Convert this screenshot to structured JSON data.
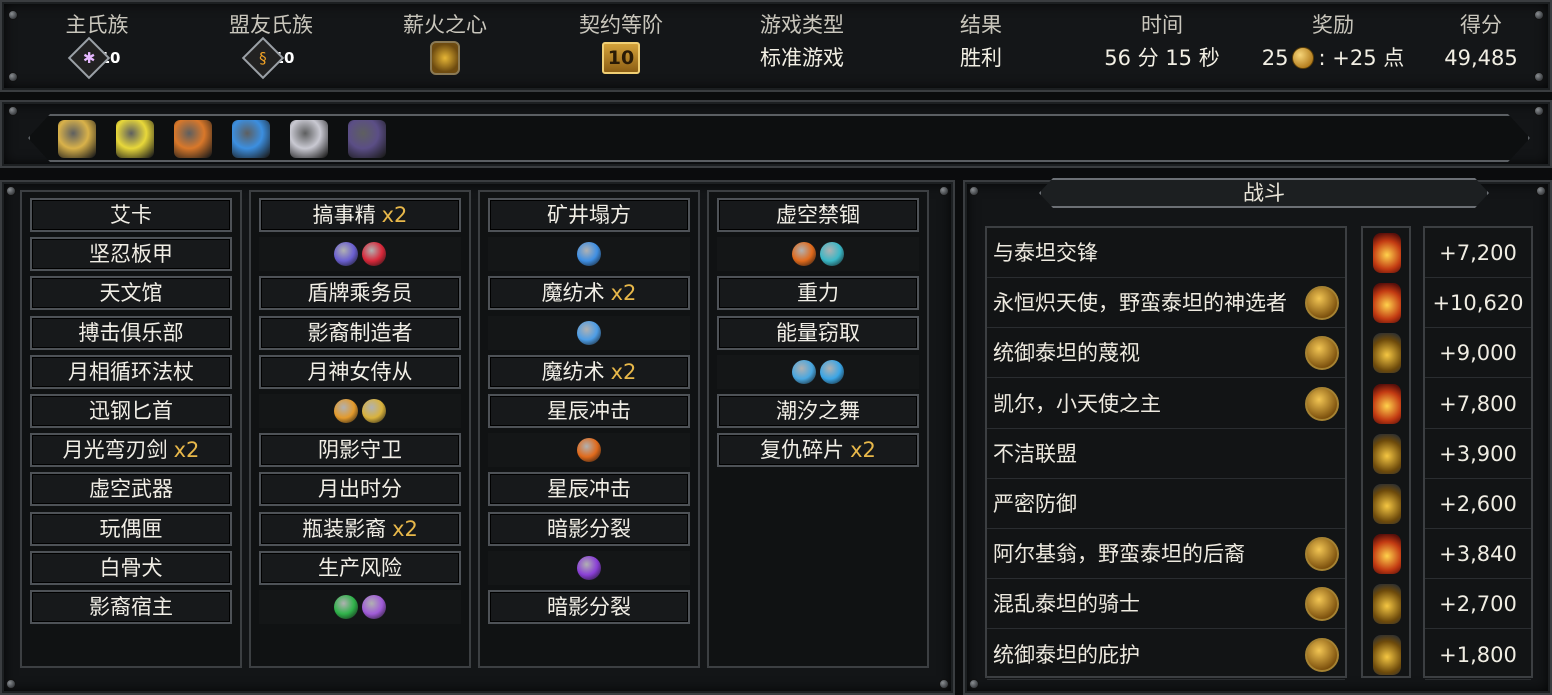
{
  "stats": [
    {
      "label": "主氏族",
      "value": "10",
      "kind": "tribe",
      "icon": "spider-icon"
    },
    {
      "label": "盟友氏族",
      "value": "10",
      "kind": "tribe",
      "icon": "flame-rune-icon"
    },
    {
      "label": "薪火之心",
      "value": "",
      "kind": "orb",
      "icon": "ember-heart-icon"
    },
    {
      "label": "契约等阶",
      "value": "10",
      "kind": "book",
      "icon": "covenant-book-icon"
    },
    {
      "label": "游戏类型",
      "value": "标准游戏",
      "kind": "text"
    },
    {
      "label": "结果",
      "value": "胜利",
      "kind": "text"
    },
    {
      "label": "时间",
      "value": "56 分 15 秒",
      "kind": "text"
    },
    {
      "label": "奖励",
      "value_pre": "25",
      "value_post": ": +25 点",
      "kind": "reward"
    },
    {
      "label": "得分",
      "value": "49,485",
      "kind": "text"
    }
  ],
  "relics": [
    {
      "name": "gold-coin-relic-icon",
      "color": "#d9b24a"
    },
    {
      "name": "yellow-crystal-relic-icon",
      "color": "#e8d83a"
    },
    {
      "name": "flame-frame-relic-icon",
      "color": "#d9782a"
    },
    {
      "name": "blue-shard-relic-icon",
      "color": "#3c8fe0"
    },
    {
      "name": "silver-ring-relic-icon",
      "color": "#c9c9d2"
    },
    {
      "name": "shadow-orb-relic-icon",
      "color": "#5b4e86"
    }
  ],
  "columns": [
    [
      {
        "type": "card",
        "label": "艾卡"
      },
      {
        "type": "card",
        "label": "坚忍板甲"
      },
      {
        "type": "card",
        "label": "天文馆"
      },
      {
        "type": "card",
        "label": "搏击俱乐部"
      },
      {
        "type": "card",
        "label": "月相循环法杖"
      },
      {
        "type": "card",
        "label": "迅钢匕首"
      },
      {
        "type": "card",
        "label": "月光弯刃剑",
        "count": "x2"
      },
      {
        "type": "card",
        "label": "虚空武器"
      },
      {
        "type": "card",
        "label": "玩偶匣"
      },
      {
        "type": "card",
        "label": "白骨犬"
      },
      {
        "type": "card",
        "label": "影裔宿主"
      }
    ],
    [
      {
        "type": "card",
        "label": "搞事精",
        "count": "x2"
      },
      {
        "type": "icons",
        "icons": [
          {
            "name": "moon-icon",
            "color": "#6a5fd0"
          },
          {
            "name": "heart-icon",
            "color": "#d8283a"
          }
        ]
      },
      {
        "type": "card",
        "label": "盾牌乘务员"
      },
      {
        "type": "card",
        "label": "影裔制造者"
      },
      {
        "type": "card",
        "label": "月神女侍从"
      },
      {
        "type": "icons",
        "icons": [
          {
            "name": "boot-icon",
            "color": "#e39a2c"
          },
          {
            "name": "crown-icon",
            "color": "#d9b23c"
          }
        ]
      },
      {
        "type": "card",
        "label": "阴影守卫"
      },
      {
        "type": "card",
        "label": "月出时分"
      },
      {
        "type": "card",
        "label": "瓶装影裔",
        "count": "x2"
      },
      {
        "type": "card",
        "label": "生产风险"
      },
      {
        "type": "icons",
        "icons": [
          {
            "name": "eye-icon",
            "color": "#2fb24a"
          },
          {
            "name": "feather-icon",
            "color": "#a05bd8"
          }
        ]
      }
    ],
    [
      {
        "type": "card",
        "label": "矿井塌方"
      },
      {
        "type": "icons",
        "icons": [
          {
            "name": "star-icon",
            "color": "#3f8fe3"
          }
        ]
      },
      {
        "type": "card",
        "label": "魔纺术",
        "count": "x2"
      },
      {
        "type": "icons",
        "icons": [
          {
            "name": "spark-icon",
            "color": "#4d9de6"
          }
        ]
      },
      {
        "type": "card",
        "label": "魔纺术",
        "count": "x2"
      },
      {
        "type": "card",
        "label": "星辰冲击"
      },
      {
        "type": "icons",
        "icons": [
          {
            "name": "fire-icon",
            "color": "#e06a1c"
          }
        ]
      },
      {
        "type": "card",
        "label": "星辰冲击"
      },
      {
        "type": "card",
        "label": "暗影分裂"
      },
      {
        "type": "icons",
        "icons": [
          {
            "name": "purple-flame-icon",
            "color": "#8a3fd6"
          }
        ]
      },
      {
        "type": "card",
        "label": "暗影分裂"
      }
    ],
    [
      {
        "type": "card",
        "label": "虚空禁锢"
      },
      {
        "type": "icons",
        "icons": [
          {
            "name": "fire-icon",
            "color": "#e06a1c"
          },
          {
            "name": "cards-icon",
            "color": "#3ab7c6"
          }
        ]
      },
      {
        "type": "card",
        "label": "重力"
      },
      {
        "type": "card",
        "label": "能量窃取"
      },
      {
        "type": "icons",
        "icons": [
          {
            "name": "crystal-card-icon",
            "color": "#49a7e0"
          },
          {
            "name": "cube-icon",
            "color": "#3aa5e6"
          }
        ]
      },
      {
        "type": "card",
        "label": "潮汐之舞"
      },
      {
        "type": "card",
        "label": "复仇碎片",
        "count": "x2"
      }
    ]
  ],
  "battle": {
    "title": "战斗",
    "rows": [
      {
        "name": "与泰坦交锋",
        "badge": "",
        "torch": "hot",
        "score": "+7,200"
      },
      {
        "name": "永恒炽天使，野蛮泰坦的神选者",
        "badge": "wing-badge-icon",
        "torch": "hot",
        "score": "+10,620"
      },
      {
        "name": "统御泰坦的蔑视",
        "badge": "drop-badge-icon",
        "torch": "normal",
        "score": "+9,000"
      },
      {
        "name": "凯尔，小天使之主",
        "badge": "sun-badge-icon",
        "torch": "hot",
        "score": "+7,800"
      },
      {
        "name": "不洁联盟",
        "badge": "",
        "torch": "normal",
        "score": "+3,900"
      },
      {
        "name": "严密防御",
        "badge": "",
        "torch": "normal",
        "score": "+2,600"
      },
      {
        "name": "阿尔基翁，野蛮泰坦的后裔",
        "badge": "fist-badge-icon",
        "torch": "hot",
        "score": "+3,840"
      },
      {
        "name": "混乱泰坦的骑士",
        "badge": "hex-badge-icon",
        "torch": "normal",
        "score": "+2,700"
      },
      {
        "name": "统御泰坦的庇护",
        "badge": "gold-bar-badge-icon",
        "torch": "normal",
        "score": "+1,800"
      }
    ]
  }
}
